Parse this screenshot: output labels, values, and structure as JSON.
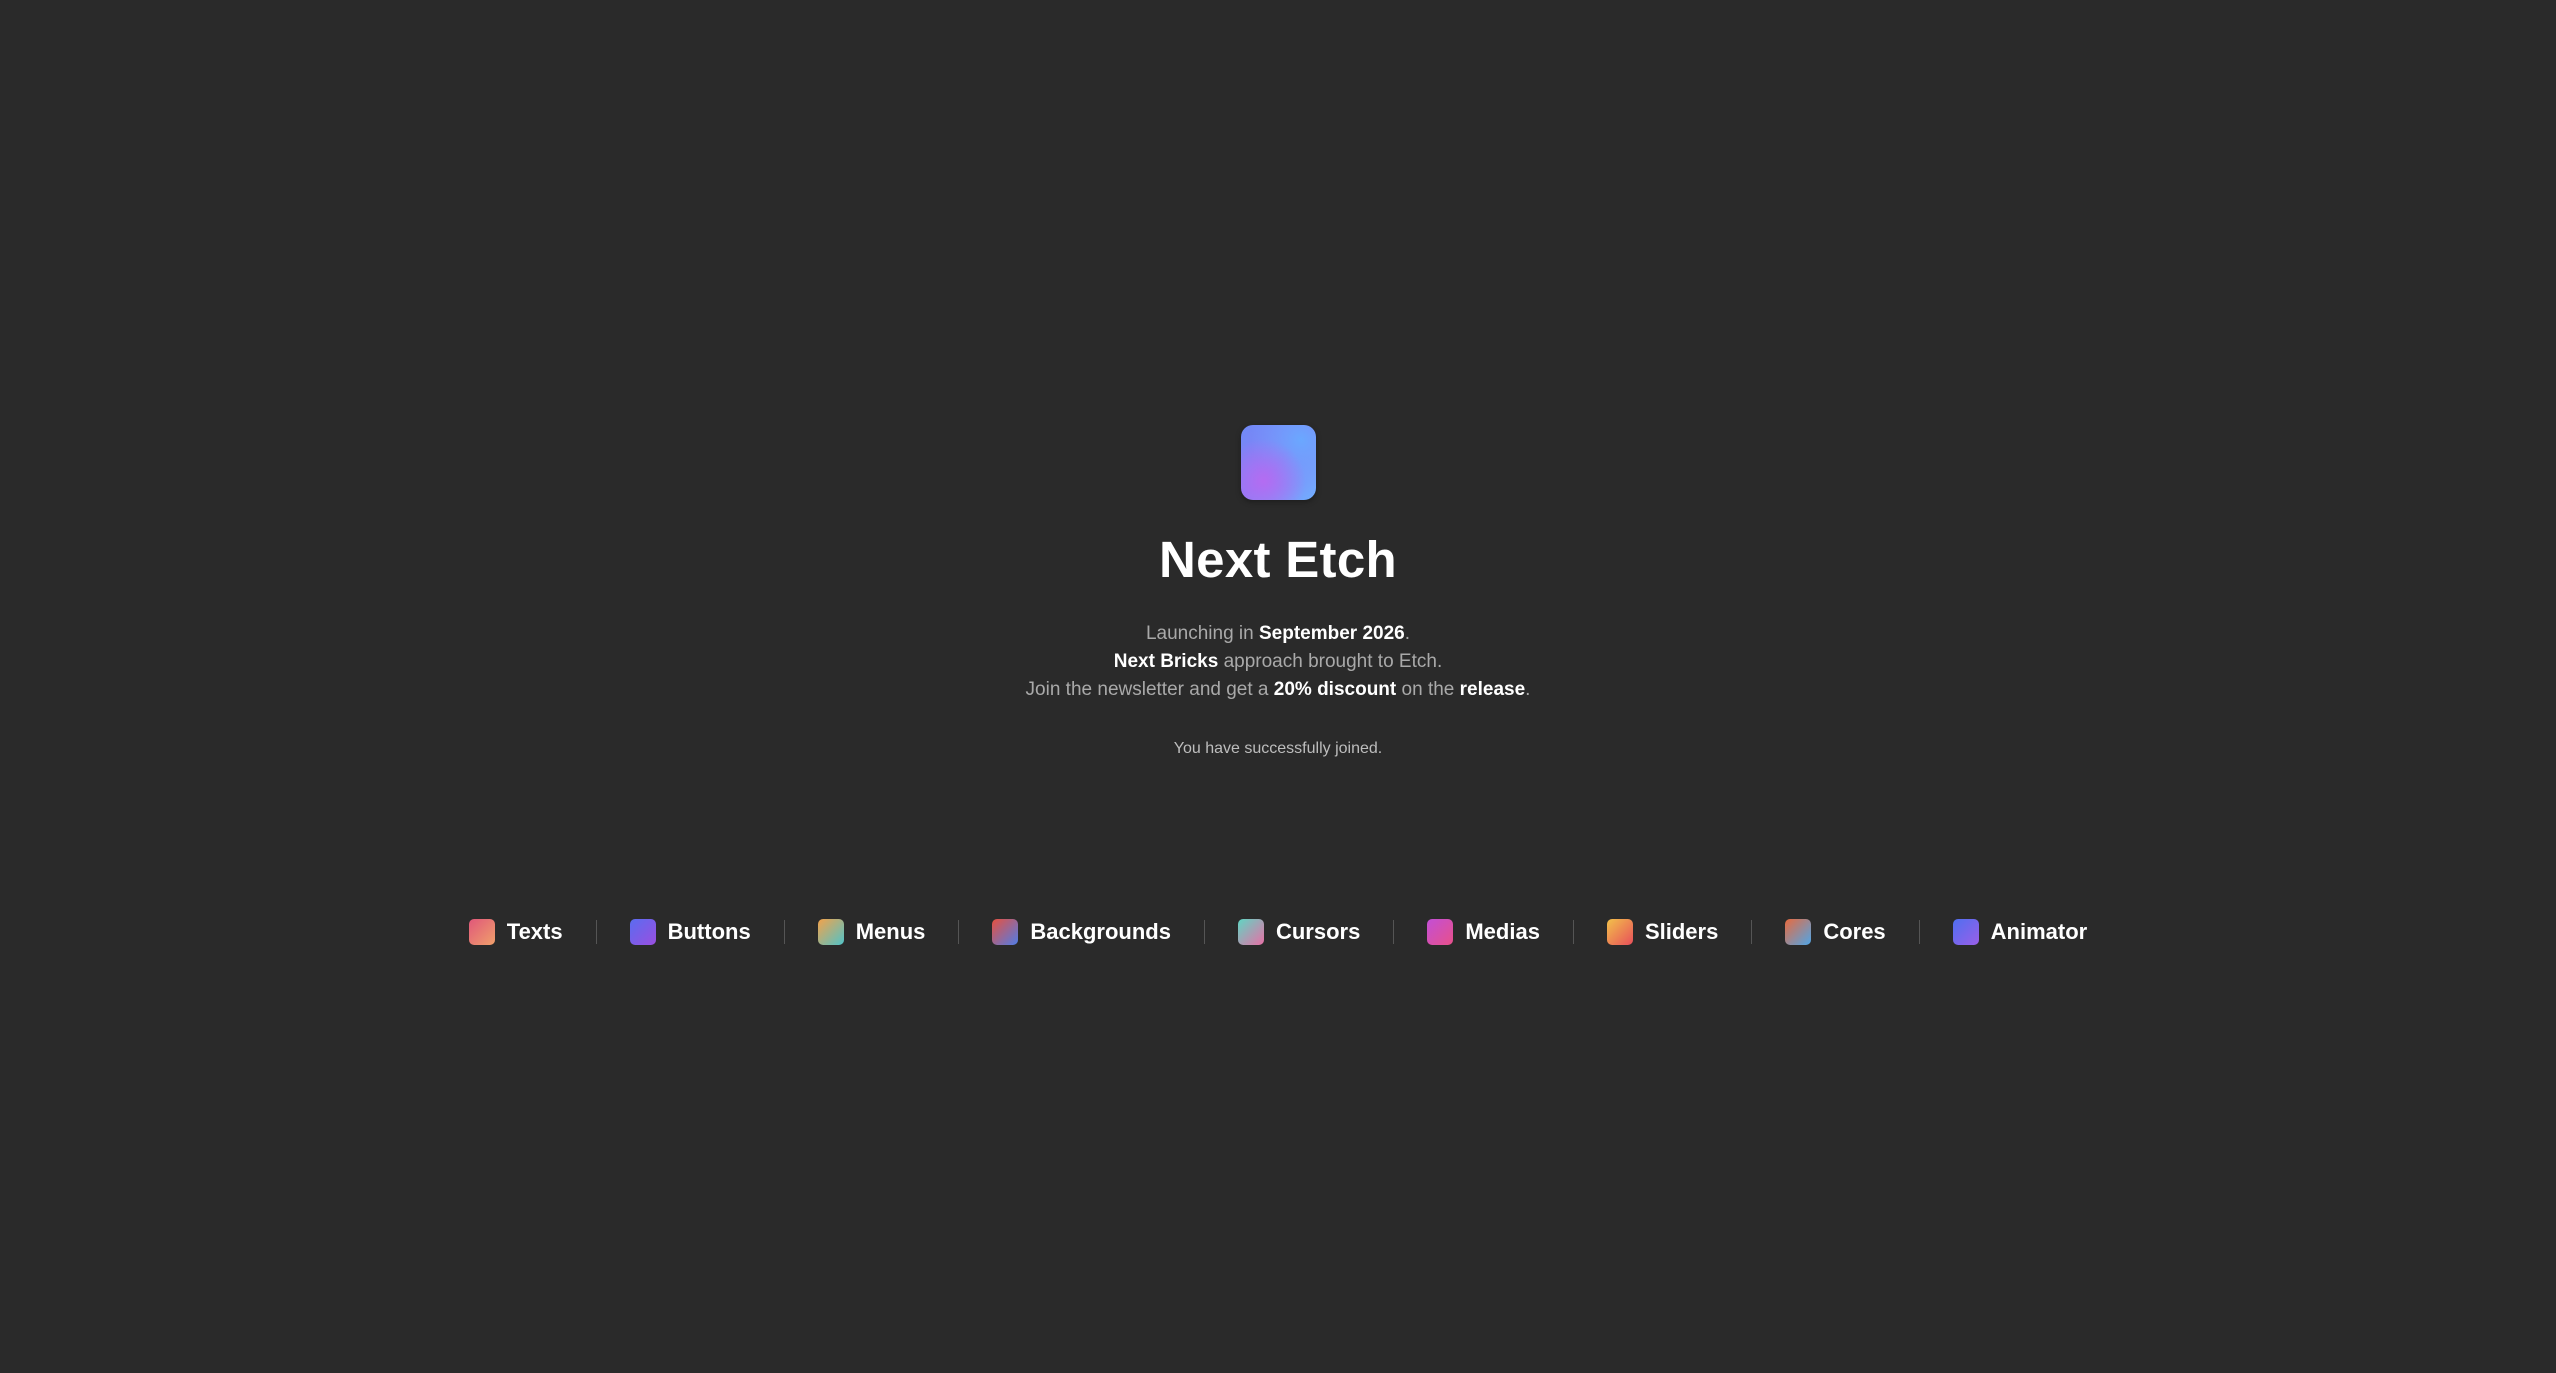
{
  "app": {
    "title": "Next Etch"
  },
  "hero": {
    "title": "Next Etch",
    "line1": {
      "prefix": "Launching in ",
      "highlight": "September 2026",
      "suffix": "."
    },
    "line2": {
      "highlight": "Next Bricks",
      "suffix": " approach brought to Etch."
    },
    "line3": {
      "prefix": "Join the newsletter and get a ",
      "highlight1": "20% discount",
      "middle": " on the ",
      "highlight2": "release",
      "suffix": "."
    },
    "status": "You have successfully joined."
  },
  "nav": {
    "items": [
      {
        "label": "Texts",
        "icon": "texts-icon",
        "colors": [
          "#e0577a",
          "#f0a06b"
        ]
      },
      {
        "label": "Buttons",
        "icon": "buttons-icon",
        "colors": [
          "#5a6cf0",
          "#9a4fe0"
        ]
      },
      {
        "label": "Menus",
        "icon": "menus-icon",
        "colors": [
          "#f3a24a",
          "#4fc3c9"
        ]
      },
      {
        "label": "Backgrounds",
        "icon": "backgrounds-icon",
        "colors": [
          "#e8503e",
          "#4f7de8"
        ]
      },
      {
        "label": "Cursors",
        "icon": "cursors-icon",
        "colors": [
          "#5fd6c3",
          "#e86fa6"
        ]
      },
      {
        "label": "Medias",
        "icon": "medias-icon",
        "colors": [
          "#c24fd6",
          "#e8508a"
        ]
      },
      {
        "label": "Sliders",
        "icon": "sliders-icon",
        "colors": [
          "#f2c14a",
          "#e84f5a"
        ]
      },
      {
        "label": "Cores",
        "icon": "cores-icon",
        "colors": [
          "#e86a3e",
          "#4fa6e8"
        ]
      },
      {
        "label": "Animator",
        "icon": "animator-icon",
        "colors": [
          "#4f6ff0",
          "#9a5fe8"
        ]
      }
    ]
  }
}
